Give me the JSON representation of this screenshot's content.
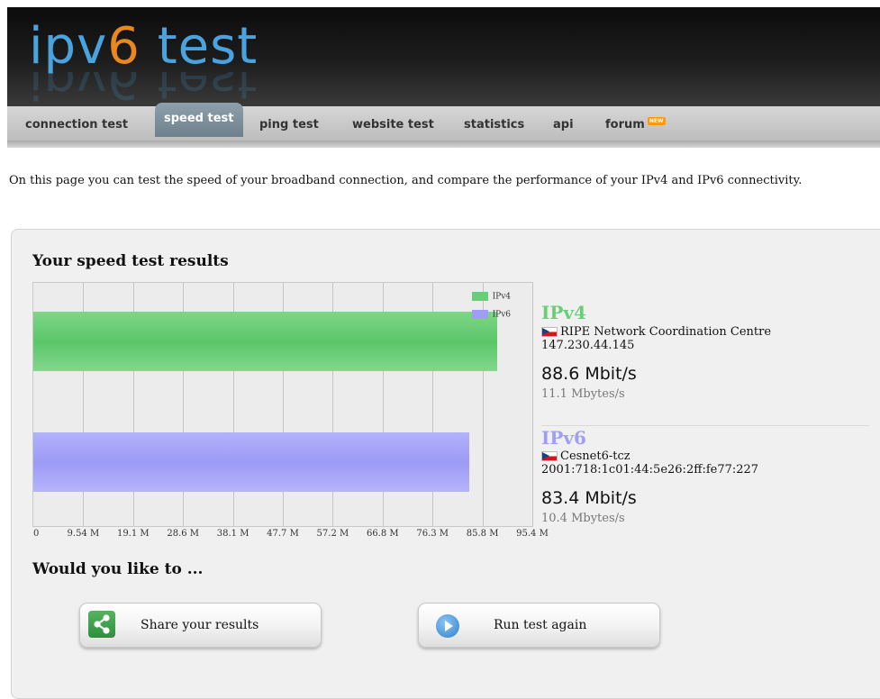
{
  "logo": {
    "part1": "ipv",
    "part2": "6",
    "part3": " test"
  },
  "nav": {
    "items": [
      {
        "label": "connection test"
      },
      {
        "label": "speed test",
        "active": true
      },
      {
        "label": "ping test"
      },
      {
        "label": "website test"
      },
      {
        "label": "statistics"
      },
      {
        "label": "api"
      },
      {
        "label": "forum",
        "badge": "NEW"
      }
    ]
  },
  "intro": "On this page you can test the speed of your broadband connection, and compare the performance of your IPv4 and IPv6 connectivity.",
  "results": {
    "heading": "Your speed test results",
    "ipv4": {
      "label": "IPv4",
      "provider": "RIPE Network Coordination Centre",
      "address": "147.230.44.145",
      "speed": "88.6 Mbit/s",
      "bytes": "11.1 Mbytes/s",
      "color": "#6ccd79"
    },
    "ipv6": {
      "label": "IPv6",
      "provider": "Cesnet6-tcz",
      "address": "2001:718:1c01:44:5e26:2ff:fe77:227",
      "speed": "83.4 Mbit/s",
      "bytes": "10.4 Mbytes/s",
      "color": "#9f9ef7"
    }
  },
  "chart_data": {
    "type": "bar",
    "orientation": "horizontal",
    "categories": [
      "IPv4",
      "IPv6"
    ],
    "series": [
      {
        "name": "IPv4",
        "values": [
          88.6
        ]
      },
      {
        "name": "IPv6",
        "values": [
          83.4
        ]
      }
    ],
    "xlim": [
      0,
      95.4
    ],
    "xticks": [
      "0",
      "9.54 M",
      "19.1 M",
      "28.6 M",
      "38.1 M",
      "47.7 M",
      "57.2 M",
      "66.8 M",
      "76.3 M",
      "85.8 M",
      "95.4 M"
    ],
    "legend": "top-right",
    "grid": true
  },
  "actions": {
    "heading": "Would you like to ...",
    "share": "Share your results",
    "run": "Run test again"
  }
}
